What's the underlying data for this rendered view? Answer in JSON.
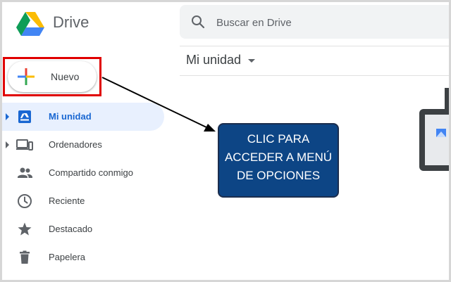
{
  "app": {
    "name": "Drive"
  },
  "search": {
    "placeholder": "Buscar en Drive"
  },
  "new_button": {
    "label": "Nuevo"
  },
  "content": {
    "title": "Mi unidad"
  },
  "sidebar": {
    "items": [
      {
        "label": "Mi unidad",
        "icon": "my-drive-icon",
        "active": true,
        "expandable": true
      },
      {
        "label": "Ordenadores",
        "icon": "computers-icon",
        "active": false,
        "expandable": true
      },
      {
        "label": "Compartido conmigo",
        "icon": "shared-icon",
        "active": false,
        "expandable": false
      },
      {
        "label": "Reciente",
        "icon": "clock-icon",
        "active": false,
        "expandable": false
      },
      {
        "label": "Destacado",
        "icon": "star-icon",
        "active": false,
        "expandable": false
      },
      {
        "label": "Papelera",
        "icon": "trash-icon",
        "active": false,
        "expandable": false
      }
    ]
  },
  "annotation": {
    "lines": [
      "CLIC PARA",
      "ACCEDER A MENÚ",
      "DE OPCIONES"
    ]
  },
  "colors": {
    "accent": "#1967d2",
    "active_bg": "#e8f0fe",
    "highlight_box": "#e00000",
    "callout_bg": "#0d4585"
  }
}
